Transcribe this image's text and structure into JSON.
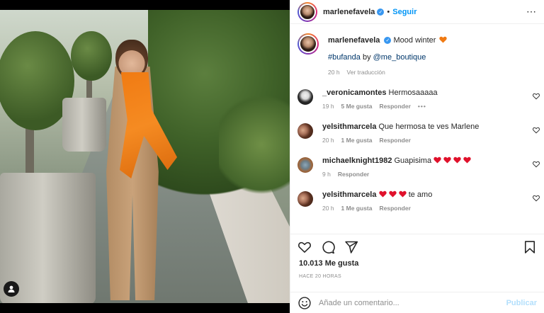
{
  "post": {
    "username": "marlenefavela",
    "follow_label": "Seguir",
    "more_icon": "more-horizontal-icon",
    "caption_user": "marlenefavela",
    "caption_text": "Mood winter",
    "caption_hashtag": "#bufanda",
    "caption_by": "by",
    "caption_mention": "@me_boutique",
    "caption_time": "20 h",
    "caption_translate": "Ver traducción"
  },
  "comments": [
    {
      "user": "_veronicamontes",
      "text": "Hermosaaaaa",
      "time": "19 h",
      "likes": "5 Me gusta",
      "reply": "Responder",
      "more": "•••"
    },
    {
      "user": "yelsithmarcela",
      "text": "Que hermosa te ves Marlene",
      "time": "20 h",
      "likes": "1 Me gusta",
      "reply": "Responder"
    },
    {
      "user": "michaelknight1982",
      "text": "Guapisima",
      "time": "9 h",
      "reply": "Responder"
    },
    {
      "user": "yelsithmarcela",
      "text": "te amo",
      "time": "20 h",
      "likes": "1 Me gusta",
      "reply": "Responder"
    }
  ],
  "footer": {
    "likes": "10.013 Me gusta",
    "time_ago": "HACE 20 HORAS",
    "comment_placeholder": "Añade un comentario...",
    "publish_label": "Publicar"
  },
  "colors": {
    "accent": "#0095f6",
    "heart": "#ed4956",
    "orange_heart": "#f07a12",
    "muted": "#8e8e8e"
  }
}
